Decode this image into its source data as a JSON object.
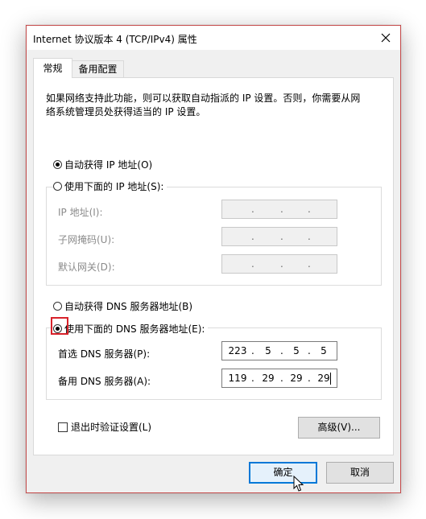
{
  "window": {
    "title": "Internet 协议版本 4 (TCP/IPv4) 属性"
  },
  "tabs": [
    {
      "label": "常规"
    },
    {
      "label": "备用配置"
    }
  ],
  "description": "如果网络支持此功能，则可以获取自动指派的 IP 设置。否则，你需要从网络系统管理员处获得适当的 IP 设置。",
  "ip": {
    "auto_label": "自动获得 IP 地址(O)",
    "manual_label": "使用下面的 IP 地址(S):",
    "address_label": "IP 地址(I):",
    "mask_label": "子网掩码(U):",
    "gateway_label": "默认网关(D):"
  },
  "dns": {
    "auto_label": "自动获得 DNS 服务器地址(B)",
    "manual_label": "使用下面的 DNS 服务器地址(E):",
    "preferred_label": "首选 DNS 服务器(P):",
    "alternate_label": "备用 DNS 服务器(A):",
    "preferred": [
      "223",
      "5",
      "5",
      "5"
    ],
    "alternate": [
      "119",
      "29",
      "29",
      "29"
    ]
  },
  "validate_label": "退出时验证设置(L)",
  "advanced_label": "高级(V)...",
  "ok_label": "确定",
  "cancel_label": "取消",
  "ip_separator": "."
}
